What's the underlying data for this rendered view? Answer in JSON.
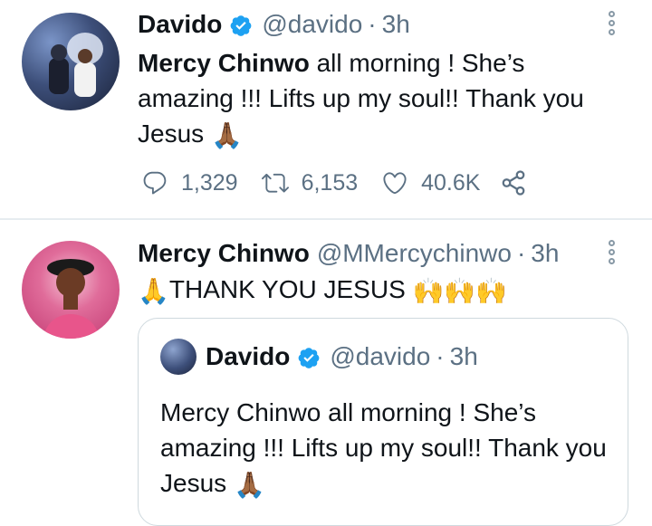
{
  "tweet1": {
    "author_name": "Davido",
    "handle": "@davido",
    "separator": "·",
    "time": "3h",
    "highlight": "Mercy Chinwo",
    "body": " all morning ! She’s amazing !!! Lifts up my soul!! Thank you Jesus",
    "emoji": "🙏🏾",
    "reply_count": "1,329",
    "retweet_count": "6,153",
    "like_count": "40.6K"
  },
  "tweet2": {
    "author_name": "Mercy Chinwo",
    "handle": "@MMercychinwo",
    "separator": "·",
    "time": "3h",
    "emoji_lead": "🙏",
    "body": "THANK YOU JESUS",
    "emoji_trail": "🙌🙌🙌",
    "quoted": {
      "author_name": "Davido",
      "handle": "@davido",
      "separator": "·",
      "time": "3h",
      "body": "Mercy Chinwo all morning ! She’s amazing !!! Lifts up my soul!! Thank you Jesus",
      "emoji": "🙏🏾"
    }
  },
  "colors": {
    "verified": "#1da1f2",
    "secondary_text": "#5b7083",
    "divider": "#e6ecf0"
  },
  "icons": [
    "verified-badge-icon",
    "more-options-icon",
    "reply-icon",
    "retweet-icon",
    "like-icon",
    "share-icon"
  ]
}
